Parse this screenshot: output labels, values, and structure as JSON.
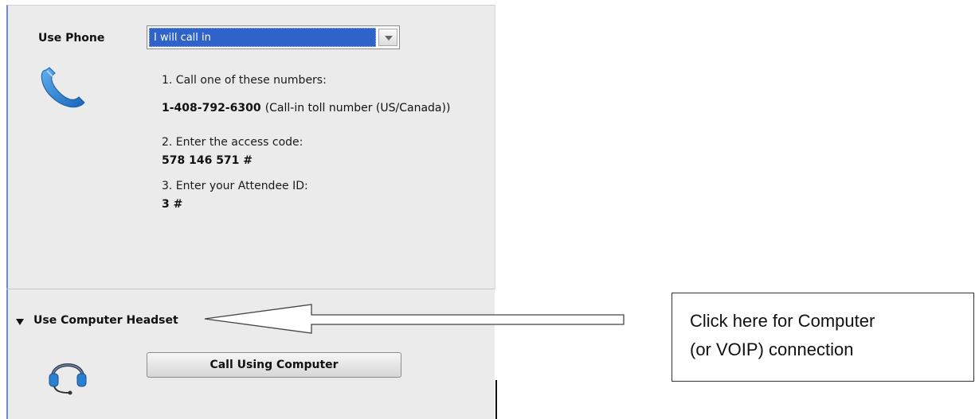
{
  "use_phone": {
    "label": "Use Phone",
    "dropdown_value": "I will call in",
    "icon": "phone-icon",
    "steps": {
      "step1": "1. Call one of these numbers:",
      "number": "1-408-792-6300",
      "number_desc": "(Call-in toll number (US/Canada))",
      "step2": "2. Enter the access code:",
      "access_code": "578 146 571 #",
      "step3": "3. Enter your Attendee ID:",
      "attendee_id": "3 #"
    }
  },
  "computer_headset": {
    "label": "Use Computer Headset",
    "icon": "headset-icon",
    "button_label": "Call Using Computer"
  },
  "annotation": {
    "line1": "Click here for Computer",
    "line2": "(or VOIP) connection"
  },
  "colors": {
    "panel_bg": "#ebebeb",
    "selection_blue": "#2f63c9",
    "icon_blue": "#2a7fd1"
  }
}
